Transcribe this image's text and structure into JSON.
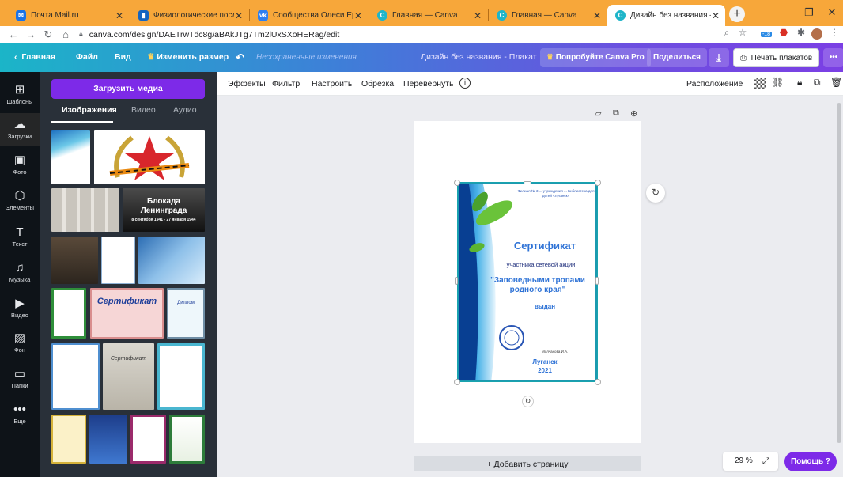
{
  "browser": {
    "tabs": [
      {
        "title": "Почта Mail.ru",
        "color": "#1a73e8"
      },
      {
        "title": "Физиологические последст",
        "color": "#1565c0"
      },
      {
        "title": "Сообщества Олеси Ершово",
        "color": "#2d7ff0"
      },
      {
        "title": "Главная — Canva",
        "color": "#1fb5c9"
      },
      {
        "title": "Главная — Canva",
        "color": "#1fb5c9"
      },
      {
        "title": "Дизайн без названия — Пл",
        "color": "#1fb5c9"
      }
    ],
    "url": "canva.com/design/DAETrwTdc8g/aBAkJTg7Tm2lUxSXoHERag/edit",
    "ext_badge": "-18"
  },
  "header": {
    "home": "Главная",
    "file": "Файл",
    "view": "Вид",
    "resize": "Изменить размер",
    "unsaved": "Несохраненные изменения",
    "doc_title": "Дизайн без названия - Плакат",
    "try_pro": "Попробуйте Canva Pro",
    "share": "Поделиться",
    "print": "Печать плакатов",
    "more": "•••"
  },
  "rail": [
    {
      "label": "Шаблоны",
      "icon": "templates-icon",
      "glyph": "⊞"
    },
    {
      "label": "Загрузки",
      "icon": "upload-cloud-icon",
      "glyph": "☁"
    },
    {
      "label": "Фото",
      "icon": "photo-icon",
      "glyph": "▣"
    },
    {
      "label": "Элементы",
      "icon": "elements-icon",
      "glyph": "⬡"
    },
    {
      "label": "Текст",
      "icon": "text-icon",
      "glyph": "T"
    },
    {
      "label": "Музыка",
      "icon": "music-icon",
      "glyph": "♫"
    },
    {
      "label": "Видео",
      "icon": "video-icon",
      "glyph": "▶"
    },
    {
      "label": "Фон",
      "icon": "background-icon",
      "glyph": "▨"
    },
    {
      "label": "Папки",
      "icon": "folder-icon",
      "glyph": "▭"
    },
    {
      "label": "Еще",
      "icon": "more-icon",
      "glyph": "•••"
    }
  ],
  "panel": {
    "upload_button": "Загрузить медиа",
    "tabs": [
      "Изображения",
      "Видео",
      "Аудио"
    ],
    "thumb_texts": {
      "blockade_title": "Блокада Ленинграда",
      "blockade_dates": "8 сентября 1941 - 27 января 1944",
      "cert1": "Сертификат",
      "diploma": "Диплом",
      "cert2": "Сертификат"
    }
  },
  "toolbar": {
    "effects": "Эффекты",
    "filter": "Фильтр",
    "adjust": "Настроить",
    "crop": "Обрезка",
    "flip": "Перевернуть",
    "position": "Расположение"
  },
  "certificate": {
    "org": "Филиал № 3 ... учреждения ... Библиотека для детей «Луганск»",
    "title": "Сертификат",
    "line1": "участника сетевой акции",
    "line2": "\"Заповедными тропами родного края\"",
    "line3": "выдан",
    "signer": "Молчанова И.А.",
    "city": "Луганск",
    "year": "2021"
  },
  "workspace": {
    "add_page": "+ Добавить страницу",
    "zoom": "29 %",
    "help": "Помощь ?"
  },
  "colors": {
    "accent_purple": "#7d2ae8",
    "rail_bg": "#0e1318",
    "panel_bg": "#293039",
    "frame_orange": "#f09a24"
  }
}
